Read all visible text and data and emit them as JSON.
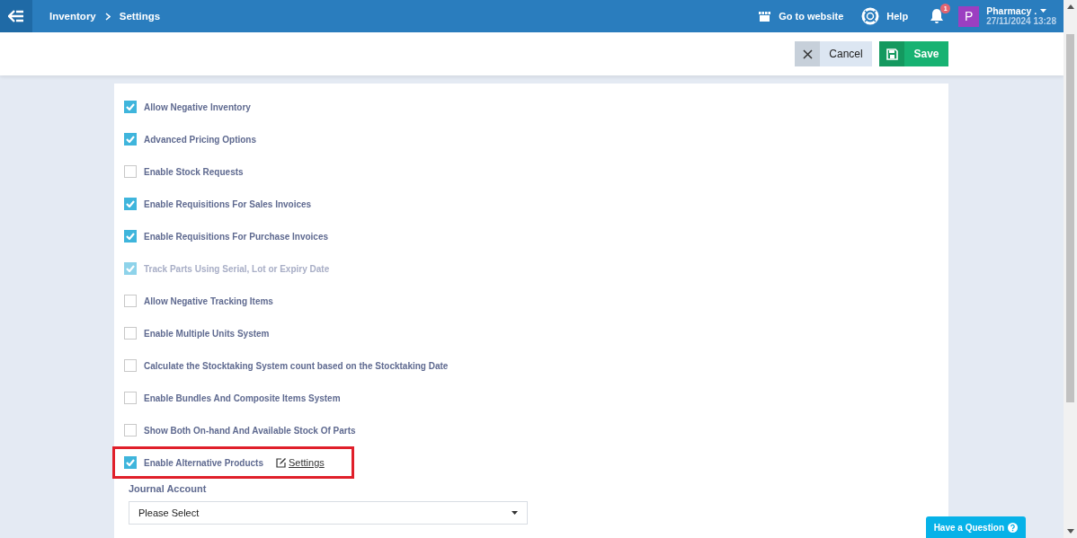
{
  "breadcrumb": [
    "Inventory",
    "Settings"
  ],
  "header": {
    "website_link": "Go to website",
    "help": "Help",
    "notification_count": "1",
    "avatar_letter": "P",
    "account": "Pharmacy .",
    "datetime": "27/11/2024 13:28"
  },
  "actions": {
    "cancel": "Cancel",
    "save": "Save"
  },
  "options": [
    {
      "label": "Allow Negative Inventory",
      "checked": true,
      "disabled": false,
      "highlighted": false
    },
    {
      "label": "Advanced Pricing Options",
      "checked": true,
      "disabled": false,
      "highlighted": false
    },
    {
      "label": "Enable Stock Requests",
      "checked": false,
      "disabled": false,
      "highlighted": false
    },
    {
      "label": "Enable Requisitions For Sales Invoices",
      "checked": true,
      "disabled": false,
      "highlighted": false
    },
    {
      "label": "Enable Requisitions For Purchase Invoices",
      "checked": true,
      "disabled": false,
      "highlighted": false
    },
    {
      "label": "Track Parts Using Serial, Lot or Expiry Date",
      "checked": true,
      "disabled": true,
      "highlighted": false
    },
    {
      "label": "Allow Negative Tracking Items",
      "checked": false,
      "disabled": false,
      "highlighted": false
    },
    {
      "label": "Enable Multiple Units System",
      "checked": false,
      "disabled": false,
      "highlighted": false
    },
    {
      "label": "Calculate the Stocktaking System count based on the Stocktaking Date",
      "checked": false,
      "disabled": false,
      "highlighted": false
    },
    {
      "label": "Enable Bundles And Composite Items System",
      "checked": false,
      "disabled": false,
      "highlighted": false
    },
    {
      "label": "Show Both On-hand And Available Stock Of Parts",
      "checked": false,
      "disabled": false,
      "highlighted": false
    },
    {
      "label": "Enable Alternative Products",
      "checked": true,
      "disabled": false,
      "highlighted": true,
      "link": "Settings"
    }
  ],
  "journal_account": {
    "label": "Journal Account",
    "value": "Please Select"
  },
  "help_button": "Have a Question"
}
